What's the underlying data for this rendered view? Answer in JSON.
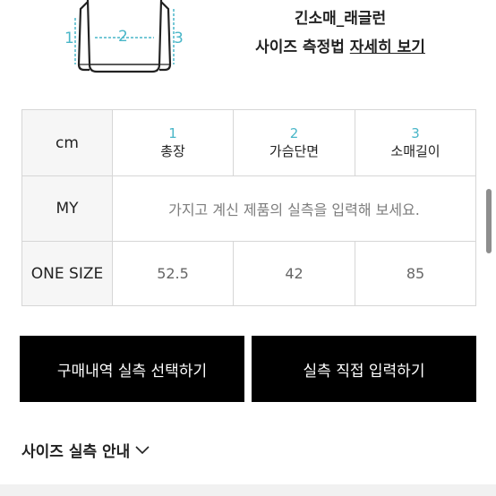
{
  "diagram": {
    "labels": [
      "1",
      "2",
      "3"
    ]
  },
  "product": {
    "title": "긴소매_래글런",
    "measure_text": "사이즈 측정법",
    "measure_link": "자세히 보기"
  },
  "table": {
    "corner": "cm",
    "columns": [
      {
        "num": "1",
        "name": "총장"
      },
      {
        "num": "2",
        "name": "가슴단면"
      },
      {
        "num": "3",
        "name": "소매길이"
      }
    ],
    "my_row": {
      "label": "MY",
      "placeholder": "가지고 계신 제품의 실측을 입력해 보세요."
    },
    "size_row": {
      "label": "ONE SIZE",
      "values": [
        "52.5",
        "42",
        "85"
      ]
    }
  },
  "buttons": {
    "select": "구매내역 실측 선택하기",
    "direct": "실측 직접 입력하기"
  },
  "guide": {
    "label": "사이즈 실측 안내"
  },
  "colors": {
    "accent": "#49b6c8",
    "button_bg": "#000000",
    "label_bg": "#f6f6f6"
  }
}
